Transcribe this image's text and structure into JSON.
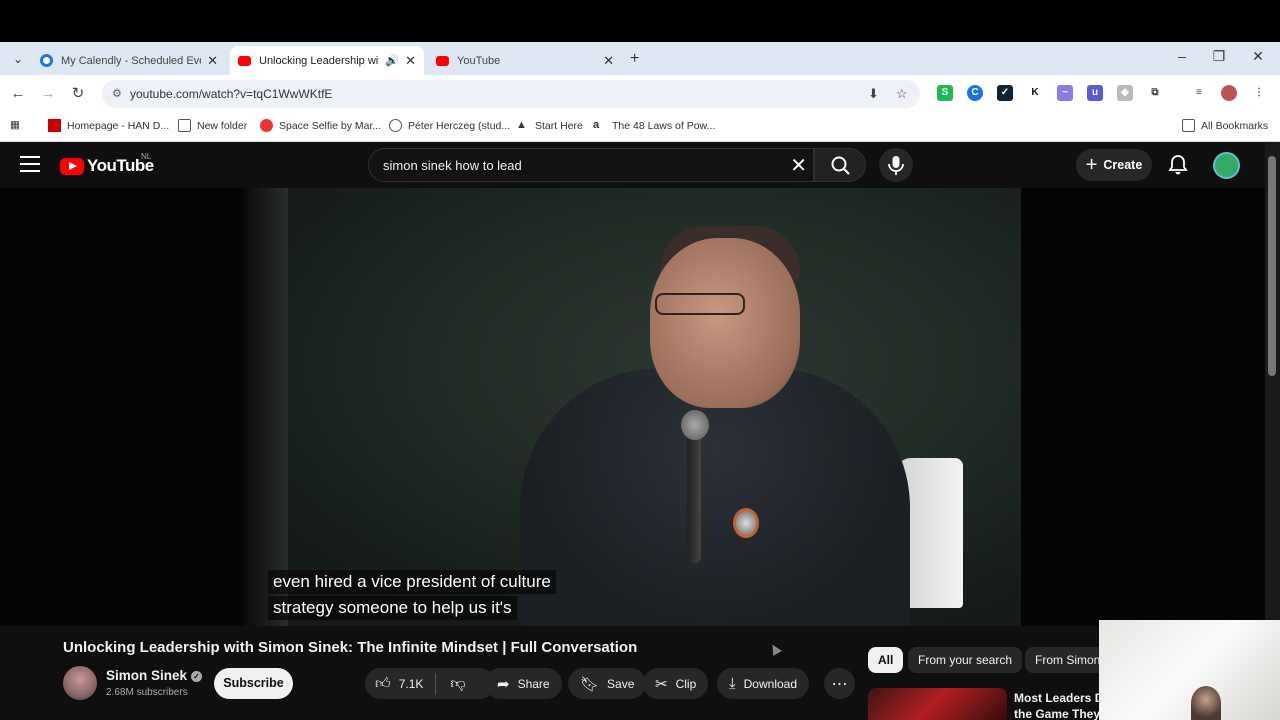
{
  "browser": {
    "tabs": [
      {
        "title": "My Calendly - Scheduled Events",
        "favicon": "calendly-icon"
      },
      {
        "title": "Unlocking Leadership with Simon Sinek",
        "favicon": "youtube-icon",
        "active": true
      },
      {
        "title": "YouTube",
        "favicon": "youtube-icon"
      }
    ],
    "url": "youtube.com/watch?v=tqC1WwWKtfE",
    "bookmarks": [
      {
        "label": "Homepage - HAN D...",
        "icon": "han-icon"
      },
      {
        "label": "New folder",
        "icon": "folder-icon"
      },
      {
        "label": "Space Selfie by Mar...",
        "icon": "space-icon"
      },
      {
        "label": "Péter Herczeg (stud...",
        "icon": "globe-icon"
      },
      {
        "label": "Start Here",
        "icon": "triangle-icon"
      },
      {
        "label": "The 48 Laws of Pow...",
        "icon": "amazon-icon"
      }
    ],
    "all_bookmarks": "All Bookmarks"
  },
  "youtube": {
    "logo_text": "YouTube",
    "country_code": "NL",
    "search_query": "simon sinek how to lead",
    "create_label": "Create",
    "captions": [
      "even hired a vice president of culture",
      "strategy someone to help us it's"
    ],
    "video_title": "Unlocking Leadership with Simon Sinek: The Infinite Mindset | Full Conversation",
    "channel_name": "Simon Sinek",
    "subscribers": "2.68M subscribers",
    "subscribe_label": "Subscribe",
    "likes": "7.1K",
    "share_label": "Share",
    "save_label": "Save",
    "clip_label": "Clip",
    "download_label": "Download",
    "chips": [
      "All",
      "From your search",
      "From Simon"
    ],
    "recommended_title_line1": "Most Leaders Do",
    "recommended_title_line2": "the Game They'r"
  }
}
